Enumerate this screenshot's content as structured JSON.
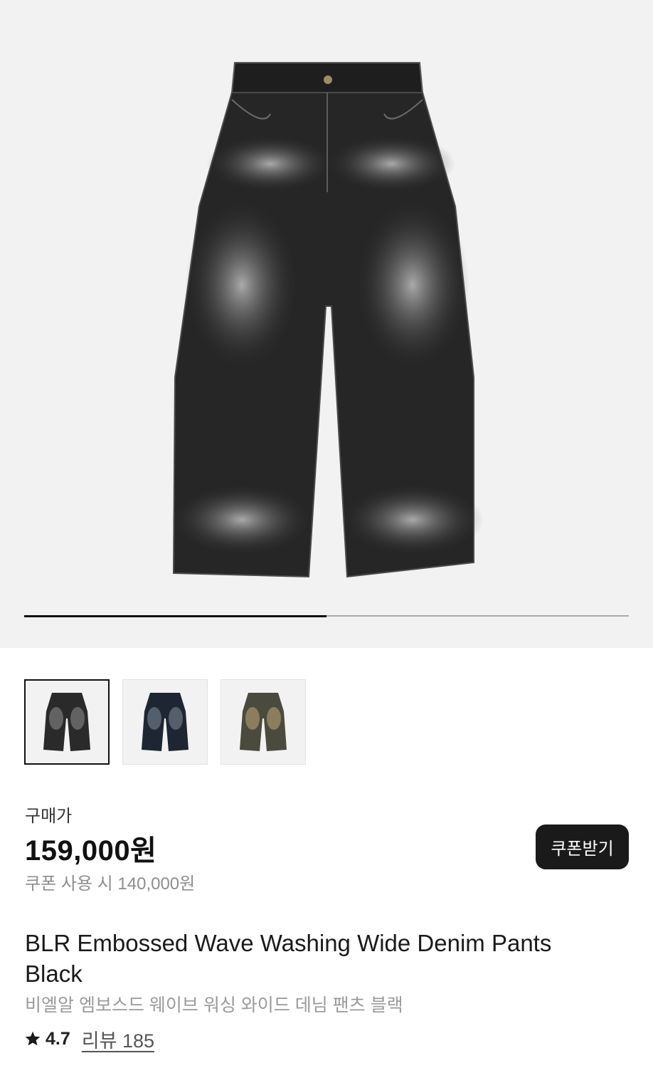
{
  "gallery": {
    "progress": 0.5,
    "thumbnails": [
      {
        "name": "black-wash",
        "selected": true
      },
      {
        "name": "blue-black-wash",
        "selected": false
      },
      {
        "name": "brown-wash",
        "selected": false
      }
    ]
  },
  "pricing": {
    "label": "구매가",
    "price": "159,000원",
    "coupon_price": "쿠폰 사용 시 140,000원",
    "coupon_button": "쿠폰받기"
  },
  "product": {
    "title_en": "BLR Embossed Wave Washing Wide Denim Pants Black",
    "title_ko": "비엘알 엠보스드 웨이브 워싱 와이드 데님 팬츠 블랙"
  },
  "rating": {
    "icon": "star-icon",
    "value": "4.7",
    "review_label": "리뷰 185"
  }
}
